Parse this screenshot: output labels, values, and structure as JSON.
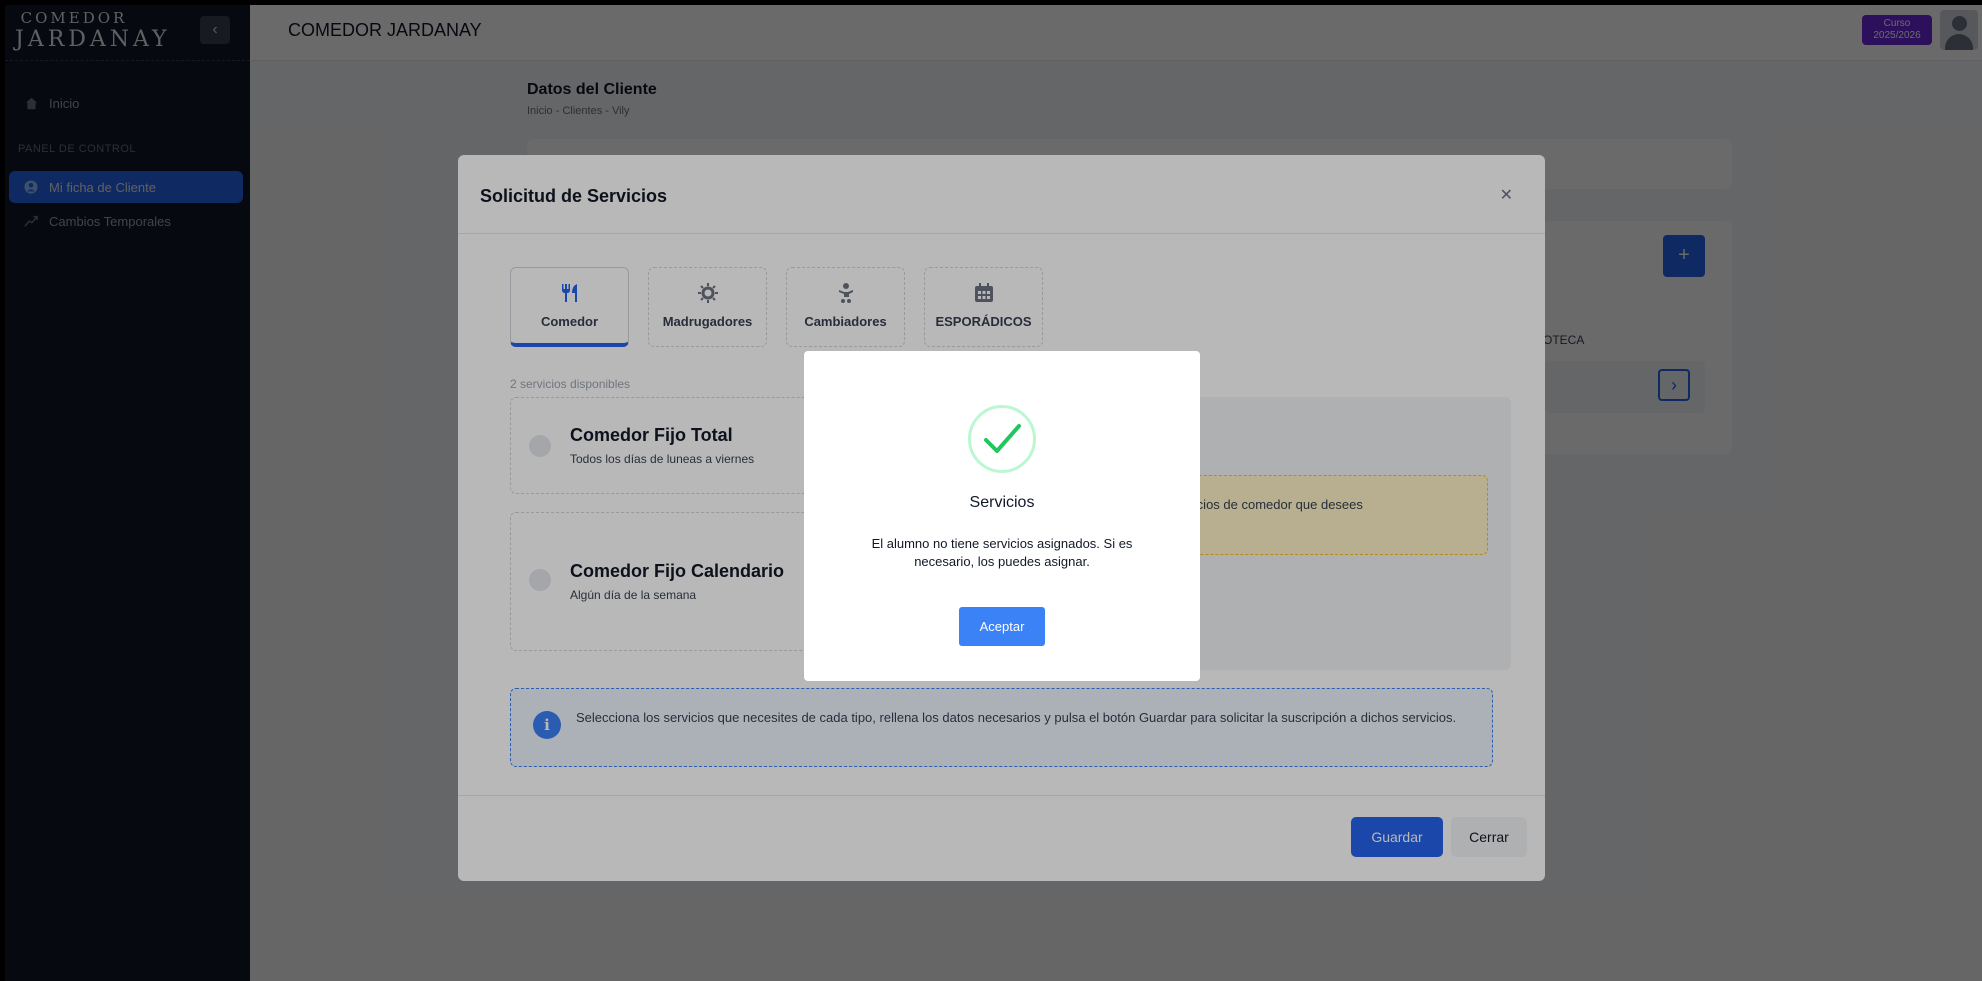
{
  "app": {
    "logo_top": "COMEDOR",
    "logo_main": "JARDANAY",
    "header_title": "COMEDOR JARDANAY",
    "course_badge_line1": "Curso",
    "course_badge_line2": "2025/2026"
  },
  "sidebar": {
    "toggle_icon": "chevron-left-icon",
    "home": {
      "label": "Inicio",
      "icon": "home-icon"
    },
    "section": "PANEL DE CONTROL",
    "items": [
      {
        "label": "Mi ficha de Cliente",
        "icon": "user-circle-icon",
        "active": true
      },
      {
        "label": "Cambios Temporales",
        "icon": "trend-icon",
        "active": false
      }
    ]
  },
  "page": {
    "title": "Datos del Cliente",
    "breadcrumb": "Inicio - Clientes - Vily",
    "bg_label": "OTECA"
  },
  "modal": {
    "title": "Solicitud de Servicios",
    "tabs": [
      {
        "label": "Comedor",
        "icon": "utensils-icon",
        "active": true
      },
      {
        "label": "Madrugadores",
        "icon": "sun-icon",
        "active": false
      },
      {
        "label": "Cambiadores",
        "icon": "baby-icon",
        "active": false
      },
      {
        "label": "ESPORÁDICOS",
        "icon": "calendar-icon",
        "active": false
      }
    ],
    "available_count": "2 servicios disponibles",
    "services": [
      {
        "name": "Comedor Fijo Total",
        "description": "Todos los días de luneas a viernes"
      },
      {
        "name": "Comedor Fijo Calendario",
        "description": "Algún día de la semana"
      }
    ],
    "warning_text": "los servicios de comedor que desees",
    "info_text": "Selecciona los servicios que necesites de cada tipo, rellena los datos necesarios y pulsa el botón Guardar para solicitar la suscripción a dichos servicios.",
    "save_label": "Guardar",
    "close_label": "Cerrar"
  },
  "alert": {
    "title": "Servicios",
    "message": "El alumno no tiene servicios asignados. Si es necesario, los puedes asignar.",
    "ok_label": "Aceptar"
  },
  "colors": {
    "primary": "#2563eb",
    "sidebar": "#111827",
    "badge": "#6d28d9",
    "success": "#22c55e"
  }
}
